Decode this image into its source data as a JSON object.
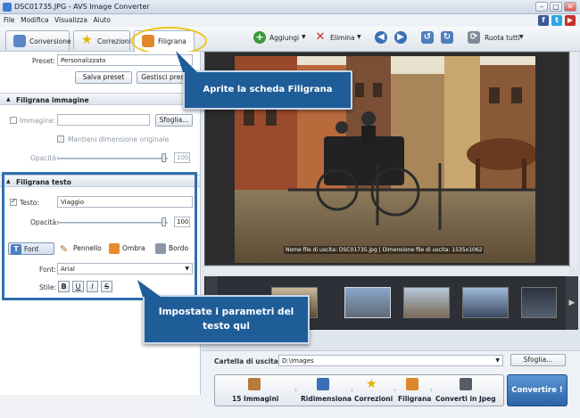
{
  "window": {
    "title": "DSC01735.JPG - AVS Image Converter"
  },
  "menu": [
    "File",
    "Modifica",
    "Visualizza",
    "Aiuto"
  ],
  "tabs": [
    {
      "label": "Conversione",
      "icon": "conversion-icon"
    },
    {
      "label": "Correzioni",
      "icon": "star-icon"
    },
    {
      "label": "Filigrana",
      "icon": "watermark-icon"
    }
  ],
  "toolbar": {
    "add_label": "Aggiungi",
    "delete_label": "Elimina",
    "rotate_all_label": "Ruota tutti"
  },
  "preset": {
    "label": "Preset:",
    "value": "Personalizzato",
    "save_label": "Salva preset",
    "manage_label": "Gestisci preset"
  },
  "image_watermark": {
    "header": "Filigrana immagine",
    "image_label": "Immagine:",
    "browse_label": "Sfoglia...",
    "keep_size_label": "Mantieni dimensione originale",
    "opacity_label": "Opacità:",
    "opacity_value": "100"
  },
  "text_watermark": {
    "header": "Filigrana testo",
    "text_label": "Testo:",
    "text_value": "Viaggio",
    "opacity_label": "Opacità:",
    "opacity_value": "100",
    "format_tabs": [
      "Font",
      "Pennello",
      "Ombra",
      "Bordo"
    ],
    "font_label": "Font:",
    "font_value": "Arial",
    "style_label": "Stile:",
    "style_buttons": [
      "B",
      "U",
      "I",
      "S"
    ]
  },
  "preview": {
    "caption": "Nome file di uscita: DSC01735.jpg | Dimensione file di uscita: 1535x1062"
  },
  "output": {
    "label": "Cartella di uscita:",
    "value": "D:\\Images",
    "browse_label": "Sfoglia..."
  },
  "pipeline": [
    {
      "label": "15 Immagini",
      "icon": "images-icon"
    },
    {
      "label": "Ridimensiona",
      "icon": "resize-icon"
    },
    {
      "label": "Correzioni",
      "icon": "star-icon"
    },
    {
      "label": "Filigrana",
      "icon": "watermark-icon"
    },
    {
      "label": "Converti in Jpeg",
      "icon": "camera-icon"
    }
  ],
  "convert_label": "Convertire !",
  "callouts": {
    "tab": "Aprite la scheda Filigrana",
    "params": "Impostate i parametri del testo qui"
  },
  "colors": {
    "accent": "#2f6fae",
    "callout": "#1f5d99",
    "highlight": "#f0c419"
  }
}
